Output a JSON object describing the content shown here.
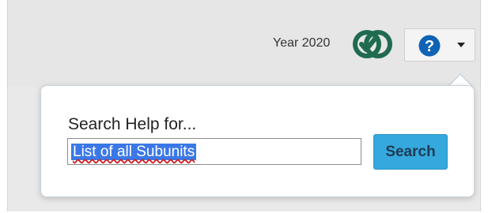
{
  "header": {
    "year_label": "Year 2020",
    "icons": {
      "sync": "sync-icon",
      "help": "help-icon",
      "caret": "caret-down-icon"
    }
  },
  "help_popover": {
    "prompt": "Search Help for...",
    "search_value": "List of all Subunits",
    "search_button_label": "Search"
  },
  "colors": {
    "sync_icon": "#1f6b50",
    "help_icon": "#0f63b4",
    "search_button": "#35a8dd",
    "selection": "#3b78e7"
  }
}
